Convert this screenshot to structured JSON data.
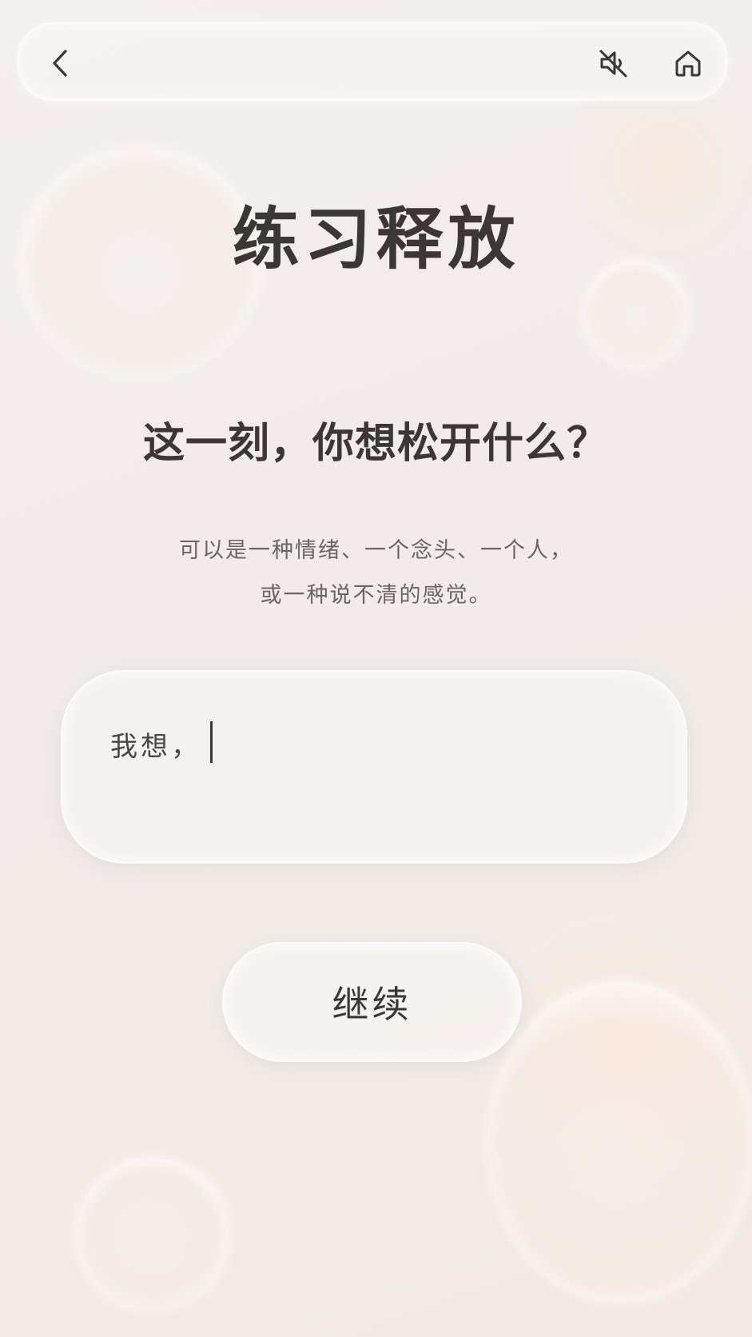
{
  "header": {
    "back_icon": "chevron-left-icon",
    "mute_icon": "speaker-muted-icon",
    "home_icon": "home-icon"
  },
  "main": {
    "title": "练习释放",
    "question": "这一刻，你想松开什么？",
    "hint_line1": "可以是一种情绪、一个念头、一个人，",
    "hint_line2": "或一种说不清的感觉。",
    "input_prefix": "我想，",
    "input_value": "",
    "continue_label": "继续"
  },
  "colors": {
    "background": "#f2ede9",
    "text": "#3a3735",
    "hint_text": "#6a6562",
    "accent_glow": "#f7ddd0"
  }
}
